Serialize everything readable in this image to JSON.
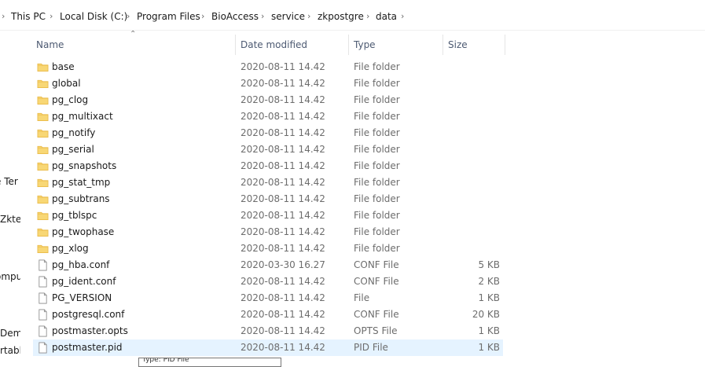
{
  "breadcrumb": [
    {
      "label": "This PC"
    },
    {
      "label": "Local Disk (C:)"
    },
    {
      "label": "Program Files"
    },
    {
      "label": "BioAccess"
    },
    {
      "label": "service"
    },
    {
      "label": "zkpostgre"
    },
    {
      "label": "data"
    }
  ],
  "nav": [
    "e Ter",
    "Zkte",
    "ompu",
    "Dem",
    "rtabl"
  ],
  "columns": {
    "name": "Name",
    "date": "Date modified",
    "type": "Type",
    "size": "Size"
  },
  "files": [
    {
      "name": "base",
      "date": "2020-08-11 14.42",
      "type": "File folder",
      "size": "",
      "kind": "folder"
    },
    {
      "name": "global",
      "date": "2020-08-11 14.42",
      "type": "File folder",
      "size": "",
      "kind": "folder"
    },
    {
      "name": "pg_clog",
      "date": "2020-08-11 14.42",
      "type": "File folder",
      "size": "",
      "kind": "folder"
    },
    {
      "name": "pg_multixact",
      "date": "2020-08-11 14.42",
      "type": "File folder",
      "size": "",
      "kind": "folder"
    },
    {
      "name": "pg_notify",
      "date": "2020-08-11 14.42",
      "type": "File folder",
      "size": "",
      "kind": "folder"
    },
    {
      "name": "pg_serial",
      "date": "2020-08-11 14.42",
      "type": "File folder",
      "size": "",
      "kind": "folder"
    },
    {
      "name": "pg_snapshots",
      "date": "2020-08-11 14.42",
      "type": "File folder",
      "size": "",
      "kind": "folder"
    },
    {
      "name": "pg_stat_tmp",
      "date": "2020-08-11 14.42",
      "type": "File folder",
      "size": "",
      "kind": "folder"
    },
    {
      "name": "pg_subtrans",
      "date": "2020-08-11 14.42",
      "type": "File folder",
      "size": "",
      "kind": "folder"
    },
    {
      "name": "pg_tblspc",
      "date": "2020-08-11 14.42",
      "type": "File folder",
      "size": "",
      "kind": "folder"
    },
    {
      "name": "pg_twophase",
      "date": "2020-08-11 14.42",
      "type": "File folder",
      "size": "",
      "kind": "folder"
    },
    {
      "name": "pg_xlog",
      "date": "2020-08-11 14.42",
      "type": "File folder",
      "size": "",
      "kind": "folder"
    },
    {
      "name": "pg_hba.conf",
      "date": "2020-03-30 16.27",
      "type": "CONF File",
      "size": "5 KB",
      "kind": "file"
    },
    {
      "name": "pg_ident.conf",
      "date": "2020-08-11 14.42",
      "type": "CONF File",
      "size": "2 KB",
      "kind": "file"
    },
    {
      "name": "PG_VERSION",
      "date": "2020-08-11 14.42",
      "type": "File",
      "size": "1 KB",
      "kind": "file"
    },
    {
      "name": "postgresql.conf",
      "date": "2020-08-11 14.42",
      "type": "CONF File",
      "size": "20 KB",
      "kind": "file"
    },
    {
      "name": "postmaster.opts",
      "date": "2020-08-11 14.42",
      "type": "OPTS File",
      "size": "1 KB",
      "kind": "file"
    },
    {
      "name": "postmaster.pid",
      "date": "2020-08-11 14.42",
      "type": "PID File",
      "size": "1 KB",
      "kind": "file",
      "selected": true
    }
  ],
  "tooltip": "Type: PID File",
  "colors": {
    "folder": "#f8d775",
    "folder_dark": "#e8b640",
    "selection": "#e5f3ff",
    "header_text": "#4d5a72"
  },
  "icons": {
    "folder": "folder-icon",
    "file": "file-icon",
    "chevron": "chevron-right-icon",
    "sort": "sort-up-icon"
  }
}
